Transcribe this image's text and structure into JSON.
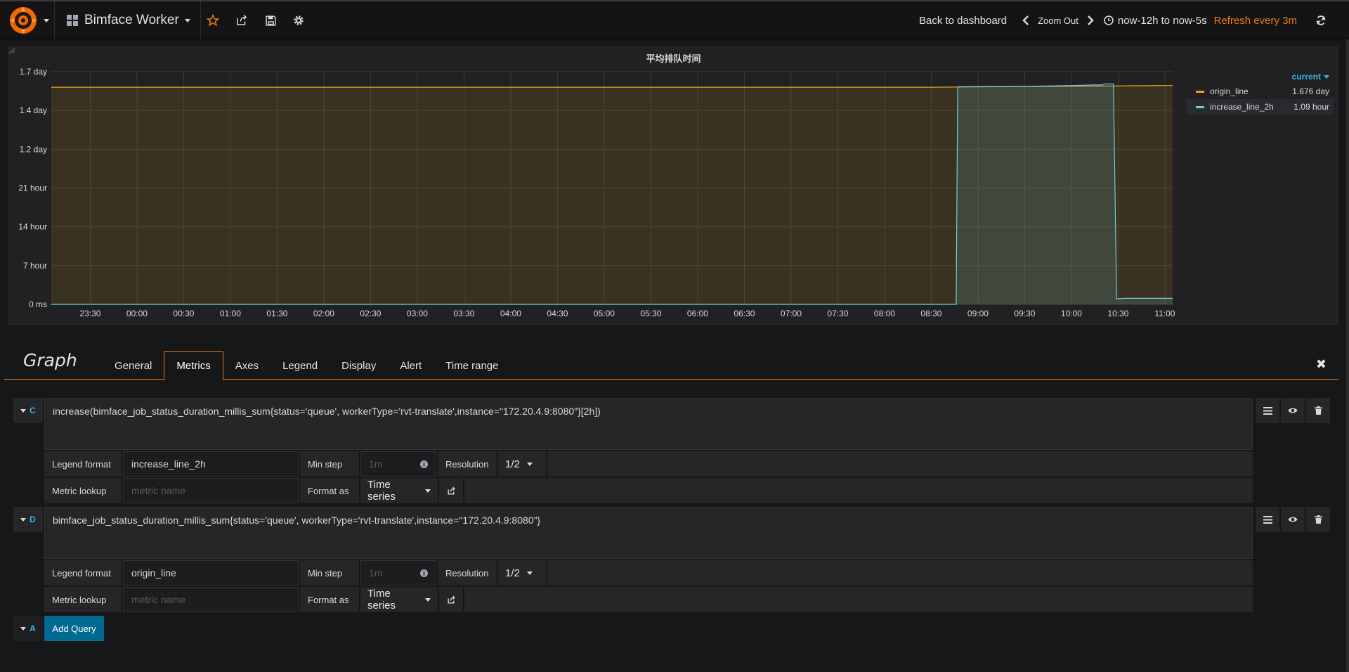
{
  "header": {
    "dashboard_title": "Bimface Worker",
    "back_label": "Back to dashboard",
    "zoom_label": "Zoom Out",
    "time_range": "now-12h to now-5s",
    "refresh_label": "Refresh every 3m"
  },
  "panel": {
    "title": "平均排队时间",
    "legend_header": "current"
  },
  "chart_data": {
    "type": "area",
    "title": "平均排队时间",
    "y_tick_labels": [
      "0 ms",
      "7 hour",
      "14 hour",
      "21 hour",
      "1.2 day",
      "1.4 day",
      "1.7 day"
    ],
    "y_tick_values_hours": [
      0,
      7,
      14,
      21,
      28,
      35,
      42
    ],
    "ylim_hours": [
      0,
      42
    ],
    "x_tick_labels": [
      "23:30",
      "00:00",
      "00:30",
      "01:00",
      "01:30",
      "02:00",
      "02:30",
      "03:00",
      "03:30",
      "04:00",
      "04:30",
      "05:00",
      "05:30",
      "06:00",
      "06:30",
      "07:00",
      "07:30",
      "08:00",
      "08:30",
      "09:00",
      "09:30",
      "10:00",
      "10:30",
      "11:00"
    ],
    "x_unit": "minutes since 23:30",
    "xlim": [
      -25,
      695
    ],
    "grid": true,
    "legend_position": "right",
    "series": [
      {
        "name": "origin_line",
        "color": "#e5ac0e",
        "current": "1.676 day",
        "points": [
          [
            -25,
            39.2
          ],
          [
            540,
            39.2
          ],
          [
            690,
            39.5
          ],
          [
            695,
            39.5
          ]
        ]
      },
      {
        "name": "increase_line_2h",
        "color": "#6ed0e0",
        "current": "1.09 hour",
        "points": [
          [
            -25,
            0
          ],
          [
            556,
            0
          ],
          [
            557,
            39.3
          ],
          [
            600,
            39.35
          ],
          [
            630,
            39.5
          ],
          [
            645,
            39.6
          ],
          [
            650,
            39.6
          ],
          [
            651,
            39.8
          ],
          [
            657,
            39.8
          ],
          [
            659,
            1
          ],
          [
            664,
            1.09
          ],
          [
            695,
            1.09
          ]
        ]
      }
    ]
  },
  "editor": {
    "title": "Graph",
    "tabs": [
      "General",
      "Metrics",
      "Axes",
      "Legend",
      "Display",
      "Alert",
      "Time range"
    ]
  },
  "queries": [
    {
      "ref": "C",
      "expr": "increase(bimface_job_status_duration_millis_sum{status='queue', workerType='rvt-translate',instance=\"172.20.4.9:8080\"}[2h])",
      "legend_label": "Legend format",
      "legend_value": "increase_line_2h",
      "minstep_label": "Min step",
      "minstep_placeholder": "1m",
      "resolution_label": "Resolution",
      "resolution_value": "1/2",
      "lookup_label": "Metric lookup",
      "lookup_placeholder": "metric name",
      "format_label": "Format as",
      "format_value": "Time series"
    },
    {
      "ref": "D",
      "expr": "bimface_job_status_duration_millis_sum{status='queue', workerType='rvt-translate',instance=\"172.20.4.9:8080\"}",
      "legend_label": "Legend format",
      "legend_value": "origin_line",
      "minstep_label": "Min step",
      "minstep_placeholder": "1m",
      "resolution_label": "Resolution",
      "resolution_value": "1/2",
      "lookup_label": "Metric lookup",
      "lookup_placeholder": "metric name",
      "format_label": "Format as",
      "format_value": "Time series"
    }
  ],
  "add_query": {
    "ref": "A",
    "label": "Add Query"
  }
}
